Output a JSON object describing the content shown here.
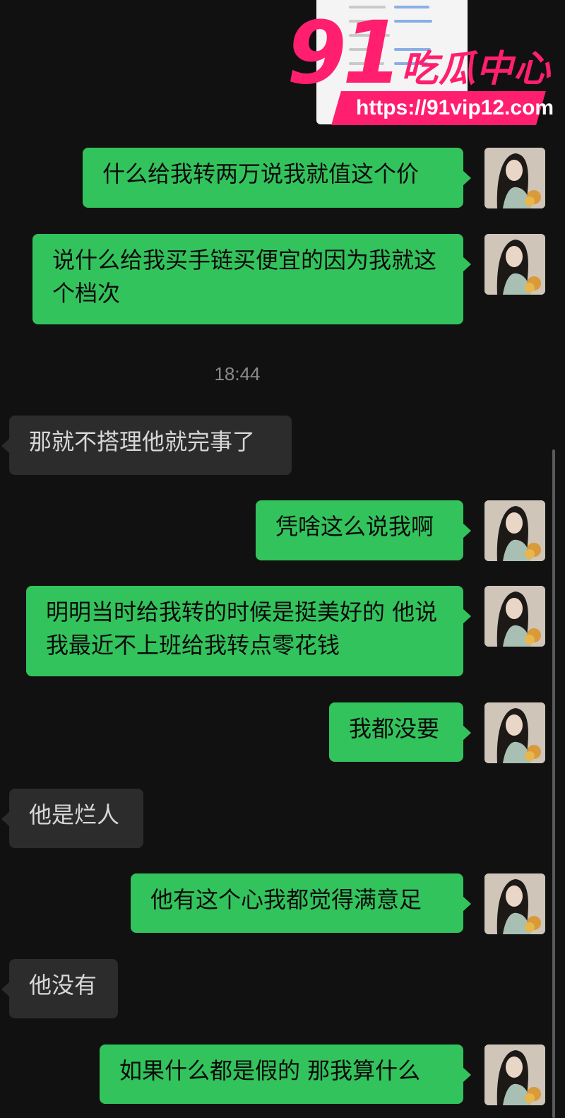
{
  "chat": {
    "timestamp": "18:44",
    "messages": [
      {
        "side": "out",
        "text": "什么给我转两万说我就值这个价"
      },
      {
        "side": "out",
        "text": "说什么给我买手链买便宜的因为我就这个档次"
      },
      {
        "side": "in",
        "text": "那就不搭理他就完事了"
      },
      {
        "side": "out",
        "text": "凭啥这么说我啊"
      },
      {
        "side": "out",
        "text": "明明当时给我转的时候是挺美好的 他说我最近不上班给我转点零花钱"
      },
      {
        "side": "out",
        "text": "我都没要"
      },
      {
        "side": "in",
        "text": "他是烂人"
      },
      {
        "side": "out",
        "text": "他有这个心我都觉得满意足"
      },
      {
        "side": "in",
        "text": "他没有"
      },
      {
        "side": "out",
        "text": "如果什么都是假的 那我算什么"
      }
    ]
  },
  "watermark": {
    "brand_number": "91",
    "brand_text": "吃瓜中心",
    "url": "https://91vip12.com",
    "color": "#ff1f6e"
  },
  "colors": {
    "background": "#111111",
    "outgoing_bubble": "#33c35c",
    "incoming_bubble": "#2c2c2c",
    "timestamp": "#8a8a8a"
  },
  "icons": {
    "avatar": "user-avatar-image"
  }
}
